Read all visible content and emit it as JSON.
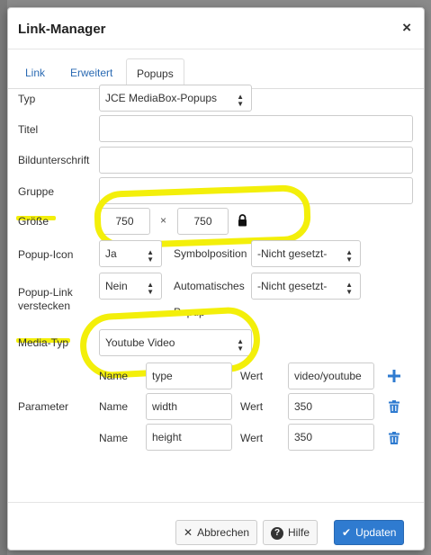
{
  "dialog": {
    "title": "Link-Manager",
    "close_glyph": "×"
  },
  "tabs": [
    {
      "label": "Link"
    },
    {
      "label": "Erweitert"
    },
    {
      "label": "Popups",
      "active": true
    }
  ],
  "form": {
    "typ": {
      "label": "Typ",
      "value": "JCE MediaBox-Popups"
    },
    "titel": {
      "label": "Titel",
      "value": ""
    },
    "bildunterschrift": {
      "label": "Bildunterschrift",
      "value": ""
    },
    "gruppe": {
      "label": "Gruppe",
      "value": ""
    },
    "groesse": {
      "label": "Größe",
      "width": "750",
      "separator": "×",
      "height": "750",
      "lock_icon": "lock-icon"
    },
    "popup_icon": {
      "label": "Popup-Icon",
      "value": "Ja"
    },
    "symbolposition": {
      "label": "Symbolposition",
      "value": "-Nicht gesetzt-"
    },
    "popup_link_verstecken": {
      "label_line1": "Popup-Link",
      "label_line2": "verstecken",
      "value": "Nein"
    },
    "automatisches_popup": {
      "label_line1": "Automatisches",
      "label_line2": "Popup",
      "value": "-Nicht gesetzt-"
    },
    "media_typ": {
      "label": "Media-Typ",
      "value": "Youtube Video"
    },
    "parameter": {
      "label": "Parameter",
      "name_label": "Name",
      "wert_label": "Wert",
      "rows": [
        {
          "name": "type",
          "wert": "video/youtube",
          "action": "add"
        },
        {
          "name": "width",
          "wert": "350",
          "action": "delete"
        },
        {
          "name": "height",
          "wert": "350",
          "action": "delete"
        }
      ]
    }
  },
  "footer": {
    "cancel_label": "Abbrechen",
    "help_label": "Hilfe",
    "update_label": "Updaten"
  },
  "colors": {
    "highlight": "#f3ef0a",
    "primary": "#2f7bd0",
    "link": "#2a6ab3"
  }
}
